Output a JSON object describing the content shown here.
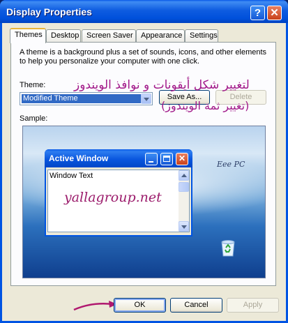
{
  "window": {
    "title": "Display Properties",
    "help_label": "?",
    "close_label": "✕"
  },
  "tabs": [
    {
      "label": "Themes",
      "active": true
    },
    {
      "label": "Desktop"
    },
    {
      "label": "Screen Saver"
    },
    {
      "label": "Appearance"
    },
    {
      "label": "Settings"
    }
  ],
  "themes": {
    "description": "A theme is a background plus a set of sounds, icons, and other elements to help you personalize your computer with one click.",
    "theme_label": "Theme:",
    "selected_theme": "Modified Theme",
    "save_as_label": "Save As...",
    "delete_label": "Delete",
    "sample_label": "Sample:"
  },
  "sample": {
    "active_window_title": "Active Window",
    "window_text": "Window Text",
    "brand_text": "Eee PC",
    "close_glyph": "✕"
  },
  "annotations": {
    "arabic_line1": "لتغيير شكل أيقونات و نوافذ الويندوز",
    "arabic_line2": "(تغيير ثمة الويندوز)",
    "website": "yallagroup.net",
    "arrow_color": "#b0186f"
  },
  "footer": {
    "ok_label": "OK",
    "cancel_label": "Cancel",
    "apply_label": "Apply"
  }
}
